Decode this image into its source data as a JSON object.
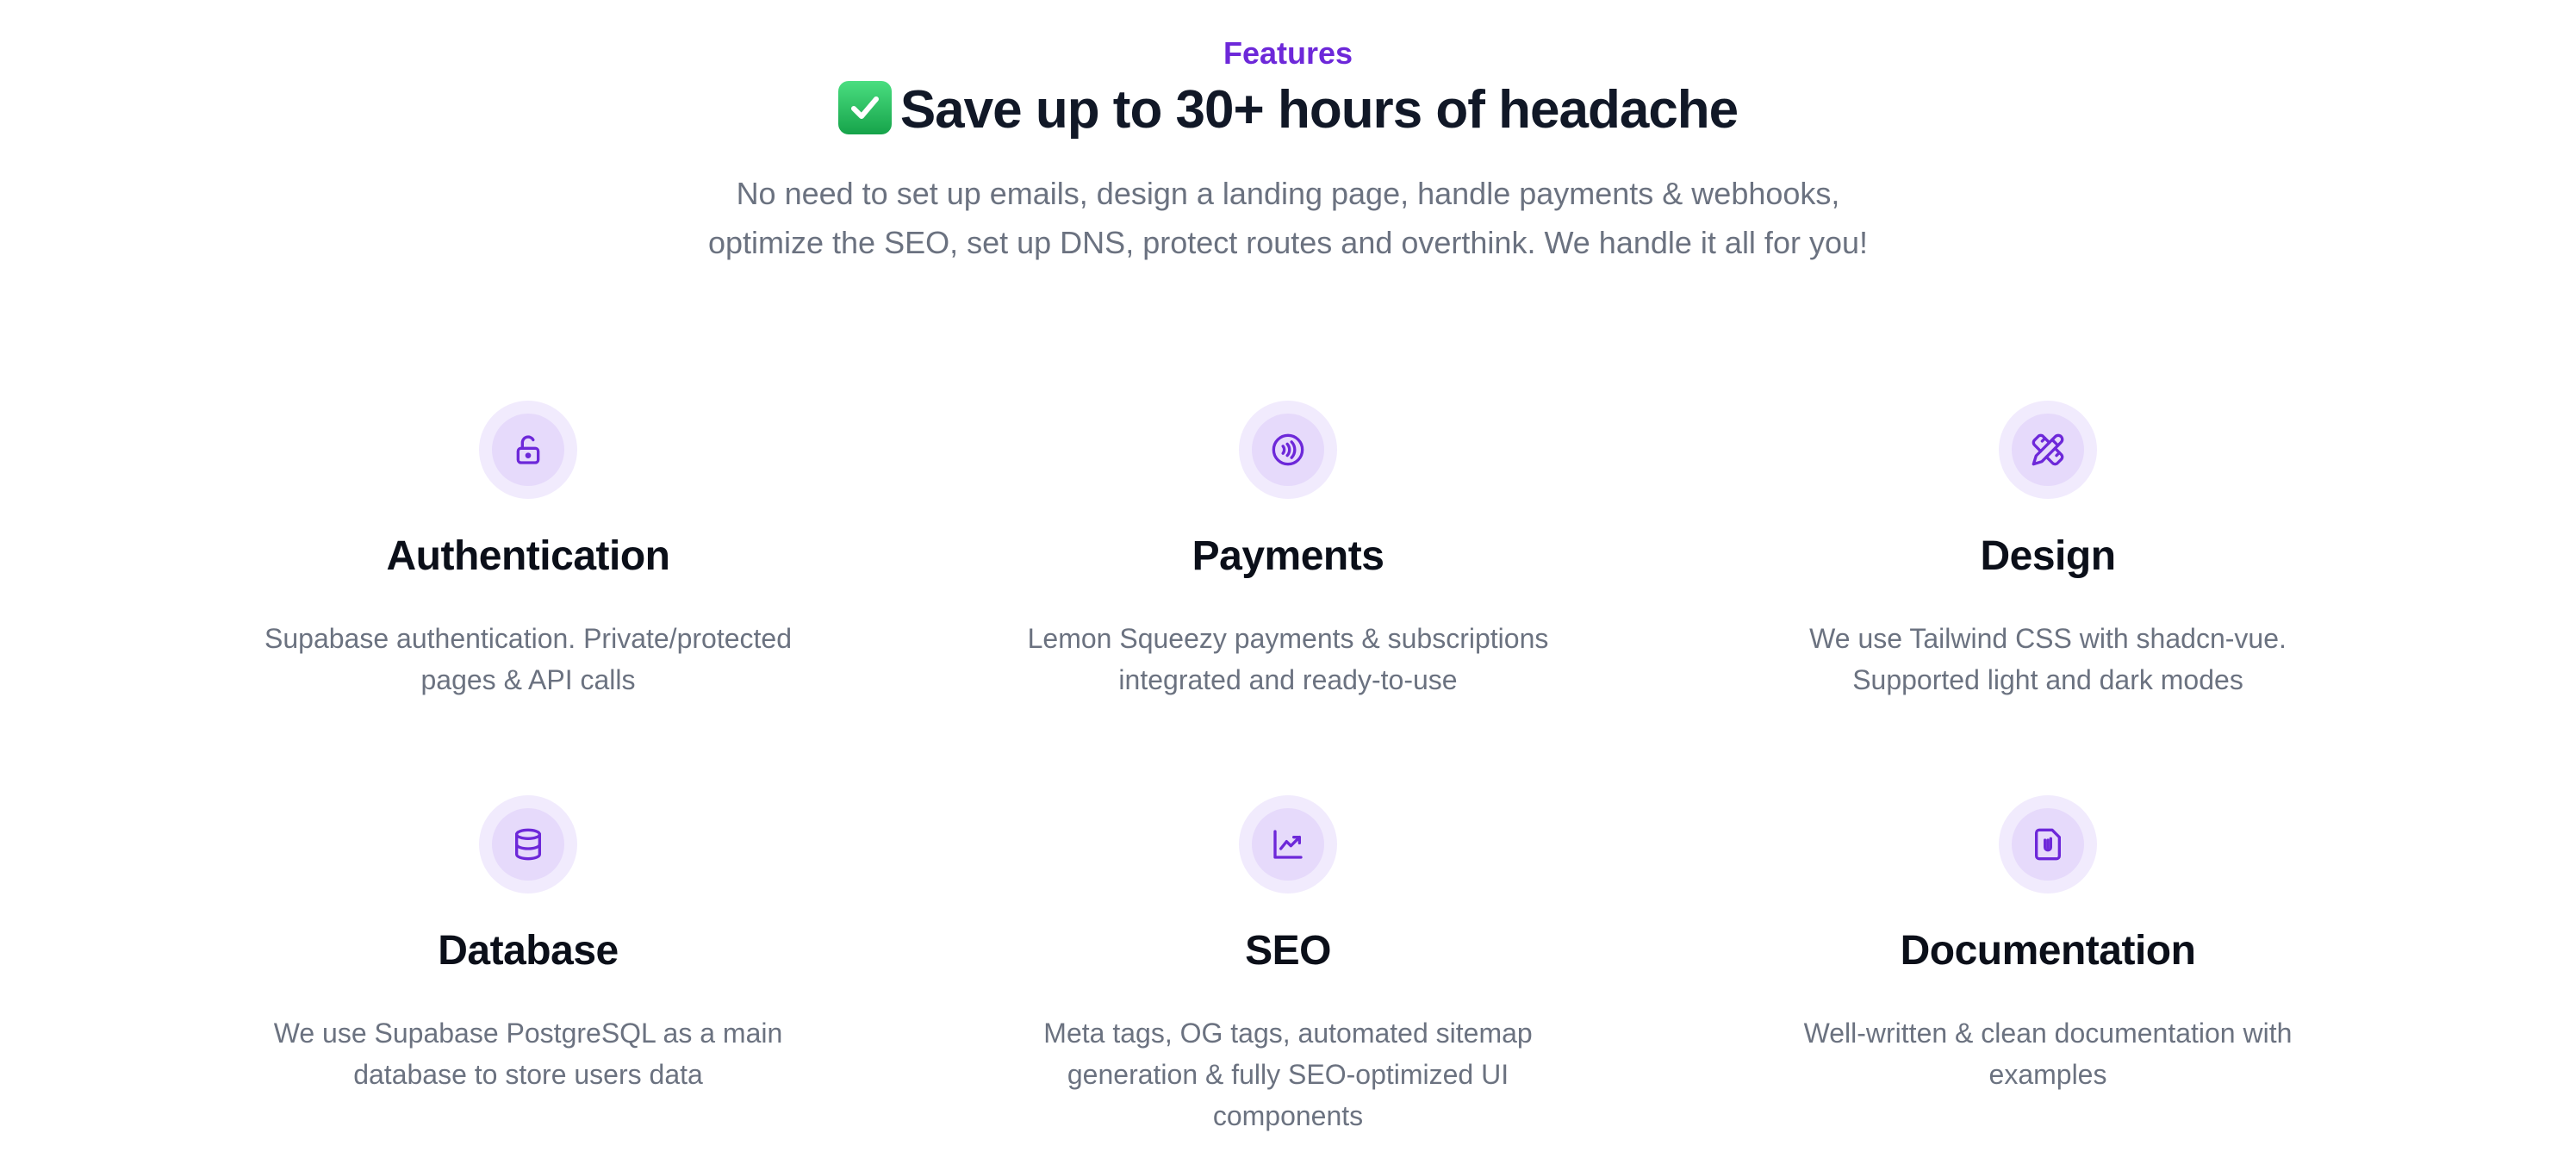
{
  "header": {
    "eyebrow": "Features",
    "headline_emoji": "✅",
    "headline": "Save up to 30+ hours of headache",
    "subtitle": "No need to set up emails, design a landing page, handle payments & webhooks, optimize the SEO, set up DNS, protect routes and overthink. We handle it all for you!"
  },
  "colors": {
    "accent": "#6d28d9",
    "icon_ring": "#f1ebfd",
    "icon_inner": "#e6dafb",
    "heading": "#111827",
    "muted": "#6b7280",
    "check": "#22c55e"
  },
  "features": [
    {
      "icon": "lock-open-icon",
      "title": "Authentication",
      "description": "Supabase authentication. Private/protected pages & API calls"
    },
    {
      "icon": "contactless-payment-icon",
      "title": "Payments",
      "description": "Lemon Squeezy payments & subscriptions integrated and ready-to-use"
    },
    {
      "icon": "pencil-ruler-icon",
      "title": "Design",
      "description": "We use Tailwind CSS with shadcn-vue. Supported light and dark modes"
    },
    {
      "icon": "database-icon",
      "title": "Database",
      "description": "We use Supabase PostgreSQL as a main database to store users data"
    },
    {
      "icon": "trending-chart-icon",
      "title": "SEO",
      "description": "Meta tags, OG tags, automated sitemap generation & fully SEO-optimized UI components"
    },
    {
      "icon": "document-attachment-icon",
      "title": "Documentation",
      "description": "Well-written & clean documentation with examples"
    }
  ]
}
